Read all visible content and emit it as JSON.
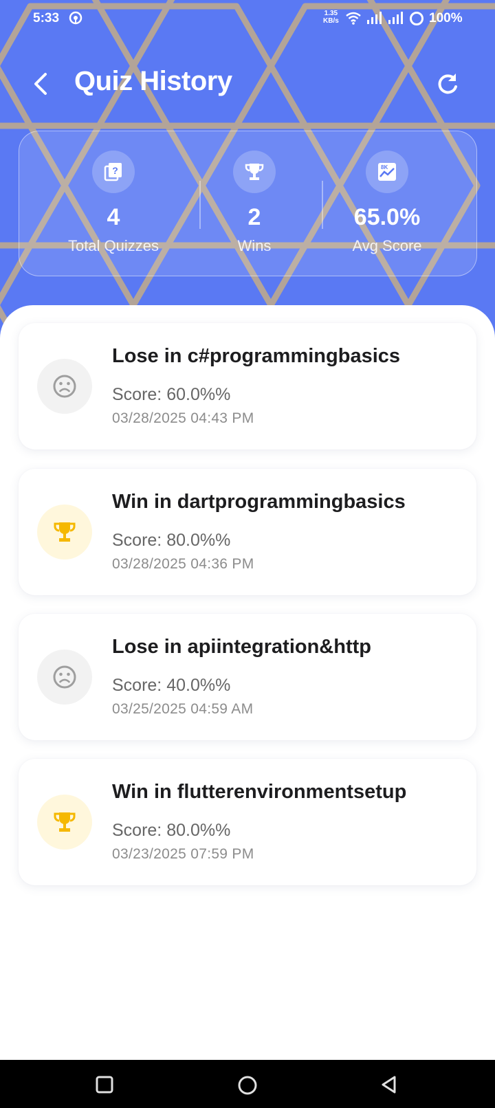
{
  "status_bar": {
    "time": "5:33",
    "net_speed_value": "1.35",
    "net_speed_unit": "KB/s",
    "battery": "100%"
  },
  "header": {
    "title": "Quiz History",
    "back_icon": "arrow-back-icon",
    "refresh_icon": "refresh-icon"
  },
  "stats": [
    {
      "icon": "quiz-library-icon",
      "value": "4",
      "label": "Total Quizzes"
    },
    {
      "icon": "trophy-icon",
      "value": "2",
      "label": "Wins"
    },
    {
      "icon": "score-chart-icon",
      "value": "65.0%",
      "label": "Avg Score"
    }
  ],
  "history": [
    {
      "result": "lose",
      "icon": "sad-face-icon",
      "title": "Lose in c#programmingbasics",
      "score": "Score: 60.0%%",
      "date": "03/28/2025 04:43 PM"
    },
    {
      "result": "win",
      "icon": "trophy-icon",
      "title": "Win in dartprogrammingbasics",
      "score": "Score: 80.0%%",
      "date": "03/28/2025 04:36 PM"
    },
    {
      "result": "lose",
      "icon": "sad-face-icon",
      "title": "Lose in apiintegration&http",
      "score": "Score: 40.0%%",
      "date": "03/25/2025 04:59 AM"
    },
    {
      "result": "win",
      "icon": "trophy-icon",
      "title": "Win in flutterenvironmentsetup",
      "score": "Score: 80.0%%",
      "date": "03/23/2025 07:59 PM"
    }
  ],
  "colors": {
    "header_bg": "#5a79f3",
    "hex_lines": "#b8a794",
    "win_icon": "#f5b800",
    "lose_icon": "#9e9e9e"
  }
}
